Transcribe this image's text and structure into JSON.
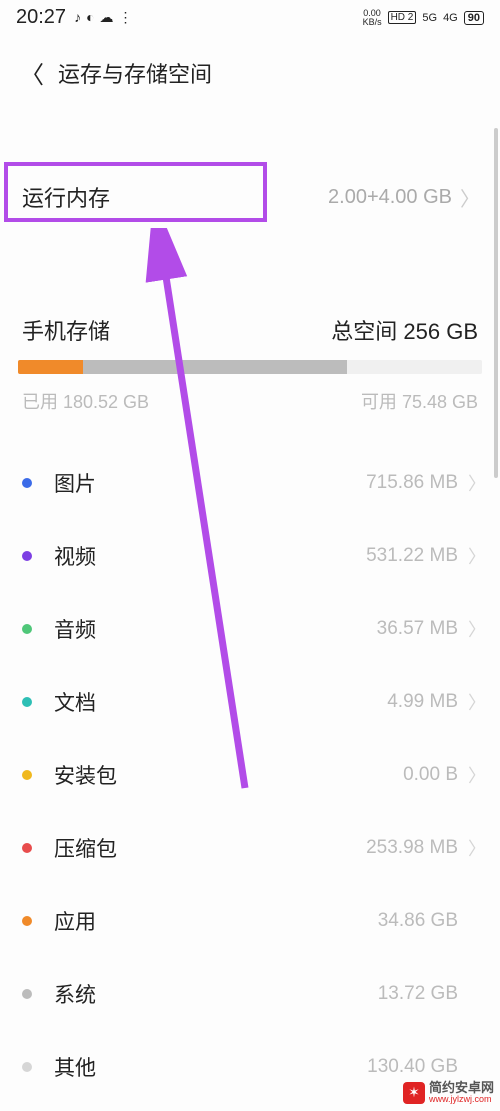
{
  "status": {
    "time": "20:27",
    "icons": [
      "♪",
      "◐",
      "☁",
      "⋮"
    ],
    "data_rate": "0.00",
    "data_unit": "KB/s",
    "hd": "HD 2",
    "net5g": "5G",
    "net4g": "4G",
    "battery": "90"
  },
  "header": {
    "title": "运存与存储空间"
  },
  "ram": {
    "label": "运行内存",
    "value": "2.00+4.00 GB"
  },
  "storage": {
    "title": "手机存储",
    "total_label": "总空间 256 GB",
    "used_label": "已用 180.52 GB",
    "free_label": "可用 75.48 GB",
    "segments": [
      {
        "color": "#f08a2a",
        "width": 14
      },
      {
        "color": "#bcbcbc",
        "width": 57
      },
      {
        "color": "#f0f0f0",
        "width": 29
      }
    ]
  },
  "categories": [
    {
      "dot": "#3b6be8",
      "label": "图片",
      "value": "715.86 MB",
      "chev": true
    },
    {
      "dot": "#7d3fe3",
      "label": "视频",
      "value": "531.22 MB",
      "chev": true
    },
    {
      "dot": "#4fc779",
      "label": "音频",
      "value": "36.57 MB",
      "chev": true
    },
    {
      "dot": "#2ebfb5",
      "label": "文档",
      "value": "4.99 MB",
      "chev": true
    },
    {
      "dot": "#f0b81e",
      "label": "安装包",
      "value": "0.00 B",
      "chev": true
    },
    {
      "dot": "#e84c4c",
      "label": "压缩包",
      "value": "253.98 MB",
      "chev": true
    },
    {
      "dot": "#f08a2a",
      "label": "应用",
      "value": "34.86 GB",
      "chev": false
    },
    {
      "dot": "#bcbcbc",
      "label": "系统",
      "value": "13.72 GB",
      "chev": false
    },
    {
      "dot": "#d6d6d6",
      "label": "其他",
      "value": "130.40 GB",
      "chev": false
    }
  ],
  "watermark": {
    "main": "简约安卓网",
    "sub": "www.jylzwj.com"
  }
}
